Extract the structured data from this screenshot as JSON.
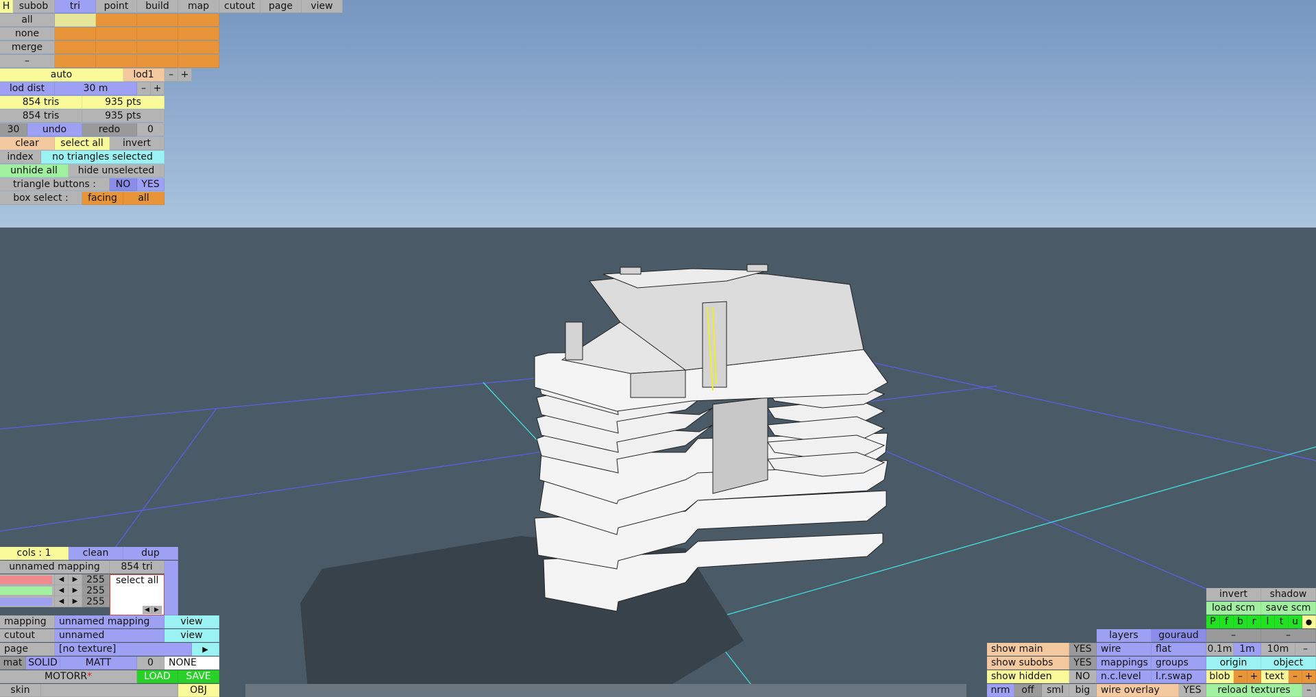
{
  "colors": {
    "sky_top": "#7898c0",
    "sky_bottom": "#a8c2dc",
    "ground": "#4a5a66",
    "grid_blue": "#5a60e0",
    "grid_cyan": "#40e0e0",
    "model": "#f2f2f2",
    "shadow": "#3a444c"
  },
  "top_tabs": [
    {
      "key": "h",
      "label": "H"
    },
    {
      "key": "subob",
      "label": "subob"
    },
    {
      "key": "tri",
      "label": "tri"
    },
    {
      "key": "point",
      "label": "point"
    },
    {
      "key": "build",
      "label": "build"
    },
    {
      "key": "map",
      "label": "map"
    },
    {
      "key": "cutout",
      "label": "cutout"
    },
    {
      "key": "page",
      "label": "page"
    },
    {
      "key": "view",
      "label": "view"
    }
  ],
  "select_rows": [
    "all",
    "none",
    "merge",
    "–"
  ],
  "lod": {
    "mode": "auto",
    "level": "lod1",
    "minus": "–",
    "plus": "+",
    "dist_label": "lod dist",
    "dist_value": "30 m"
  },
  "counts": {
    "tris1": "854 tris",
    "pts1": "935 pts",
    "tris2": "854 tris",
    "pts2": "935 pts"
  },
  "undo": {
    "steps": "30",
    "undo": "undo",
    "redo": "redo",
    "count": "0"
  },
  "selection": {
    "clear": "clear",
    "select_all": "select all",
    "invert": "invert",
    "index": "index",
    "status": "no triangles selected",
    "unhide_all": "unhide all",
    "hide_unselected": "hide unselected",
    "tri_buttons_label": "triangle buttons :",
    "no": "NO",
    "yes": "YES",
    "box_select_label": "box select :",
    "facing": "facing",
    "all": "all"
  },
  "mapping_panel": {
    "cols": "cols : 1",
    "clean": "clean",
    "dup": "dup",
    "mapping_name": "unnamed mapping",
    "tri_count": "854 tri",
    "channels": [
      {
        "value": "255",
        "color": "#f08a8a"
      },
      {
        "value": "255",
        "color": "#a0f0a0"
      },
      {
        "value": "255",
        "color": "#a0a0f0"
      }
    ],
    "select_all": "select all",
    "mapping_label": "mapping",
    "mapping_value": "unnamed mapping",
    "mapping_view": "view",
    "cutout_label": "cutout",
    "cutout_value": "unnamed",
    "cutout_view": "view",
    "page_label": "page",
    "page_value": "[no texture]",
    "mat_label": "mat",
    "solid": "SOLID",
    "matt": "MATT",
    "mat_num": "0",
    "none": "NONE",
    "material_name": "MOTORR",
    "material_mark": "*",
    "load": "LOAD",
    "save": "SAVE",
    "skin_label": "skin",
    "skin_value": "",
    "obj": "OBJ"
  },
  "right_panel": {
    "invert": "invert",
    "shadow": "shadow",
    "load_scm": "load scm",
    "save_scm": "save scm",
    "letters": [
      "P",
      "f",
      "b",
      "r",
      "l",
      "t",
      "u",
      "●"
    ],
    "layers": "layers",
    "gouraud": "gouraud",
    "dash1": "–",
    "dash2": "–",
    "show_main": "show main",
    "show_main_v": "YES",
    "wire": "wire",
    "flat": "flat",
    "scale_01": "0.1m",
    "scale_1": "1m",
    "scale_10": "10m",
    "scale_minus": "–",
    "show_subobs": "show subobs",
    "show_subobs_v": "YES",
    "mappings": "mappings",
    "groups": "groups",
    "origin": "origin",
    "object": "object",
    "show_hidden": "show hidden",
    "show_hidden_v": "NO",
    "nc_level": "n.c.level",
    "lr_swap": "l.r.swap",
    "blob": "blob",
    "blob_minus": "–",
    "blob_plus": "+",
    "text": "text",
    "text_minus": "–",
    "text_plus": "+",
    "nrm": "nrm",
    "off": "off",
    "sml": "sml",
    "big": "big",
    "wire_overlay": "wire overlay",
    "wire_overlay_v": "YES",
    "reload_textures": "reload textures",
    "reload_minus": "–"
  }
}
